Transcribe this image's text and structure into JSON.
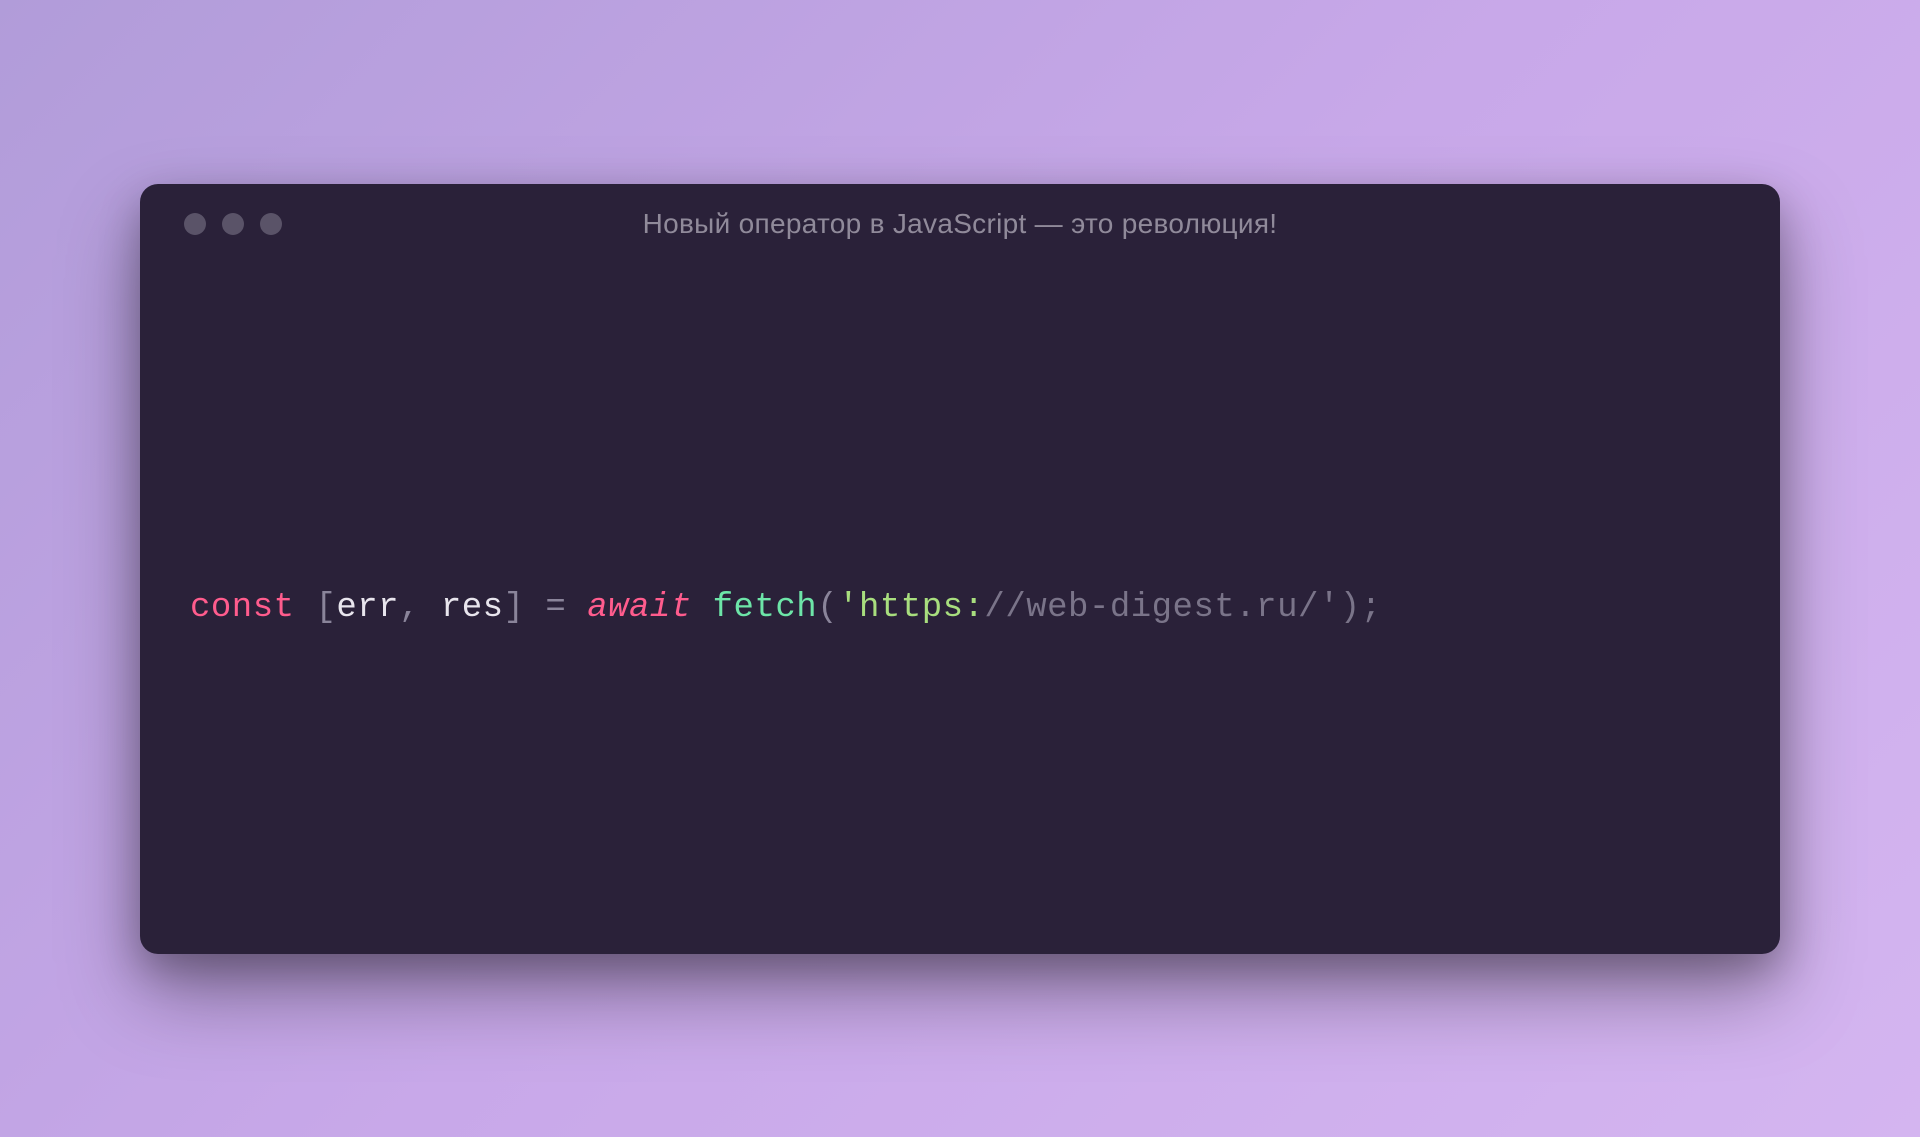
{
  "window": {
    "title": "Новый оператор в JavaScript — это революция!"
  },
  "code": {
    "tokens": {
      "const": "const",
      "space1": " ",
      "lbracket": "[",
      "err": "err",
      "comma": ",",
      "space2": " ",
      "res": "res",
      "rbracket": "]",
      "space3": " ",
      "equals": "=",
      "space4": " ",
      "await": "await",
      "space5": " ",
      "fetch": "fetch",
      "lparen": "(",
      "quote1": "'",
      "url_proto": "https:",
      "url_rest": "//web-digest.ru/",
      "quote2": "'",
      "rparen": ")",
      "semi": ";"
    }
  }
}
